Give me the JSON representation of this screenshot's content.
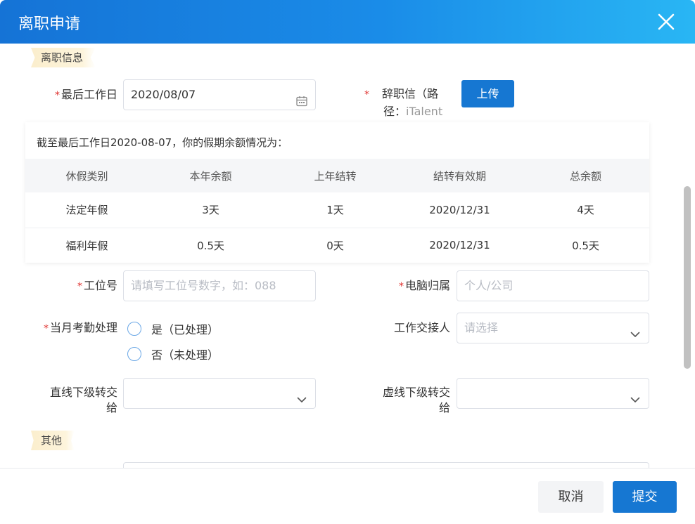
{
  "dialog": {
    "title": "离职申请"
  },
  "sections": {
    "resign_info": "离职信息",
    "other": "其他"
  },
  "required_mark": "*",
  "form": {
    "last_work_day": {
      "label": "最后工作日",
      "value": "2020/08/07",
      "icon": "calendar-icon"
    },
    "resignation_letter": {
      "label_line1": "辞职信（路",
      "label_line2_a": "径：",
      "label_line2_b": "iTalent",
      "upload_label": "上传"
    },
    "station_no": {
      "label": "工位号",
      "placeholder": "请填写工位号数字，如：088"
    },
    "computer_owner": {
      "label": "电脑归属",
      "placeholder": "个人/公司"
    },
    "attendance": {
      "label": "当月考勤处理",
      "options": [
        "是（已处理）",
        "否（未处理）"
      ]
    },
    "handover_person": {
      "label": "工作交接人",
      "placeholder": "请选择"
    },
    "direct_subordinates": {
      "label_line1": "直线下级转交",
      "label_line2": "给"
    },
    "dotted_subordinates": {
      "label_line1": "虚线下级转交",
      "label_line2": "给"
    }
  },
  "balance": {
    "intro": "截至最后工作日2020-08-07，你的假期余额情况为：",
    "headers": [
      "休假类别",
      "本年余额",
      "上年结转",
      "结转有效期",
      "总余额"
    ],
    "rows": [
      [
        "法定年假",
        "3天",
        "1天",
        "2020/12/31",
        "4天"
      ],
      [
        "福利年假",
        "0.5天",
        "0天",
        "2020/12/31",
        "0.5天"
      ]
    ]
  },
  "footer": {
    "cancel_label": "取消",
    "submit_label": "提交"
  },
  "colors": {
    "primary": "#1677d2",
    "required": "#e0322f",
    "header_gradient_start": "#1573d6",
    "header_gradient_end": "#29b6f4"
  }
}
